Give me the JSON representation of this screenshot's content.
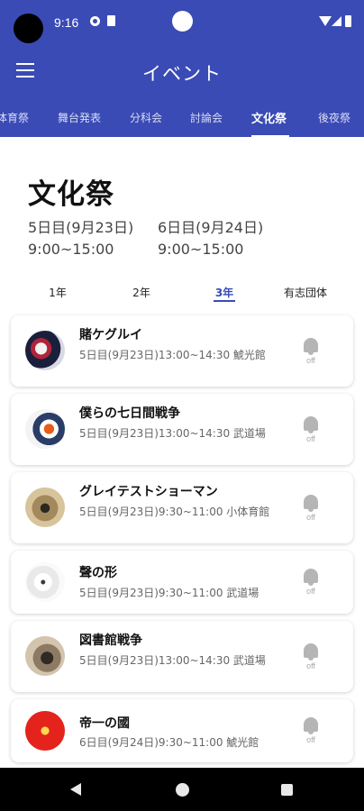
{
  "status_bar": {
    "time": "9:16"
  },
  "app_bar": {
    "title": "イベント"
  },
  "tabs": [
    "体育祭",
    "舞台発表",
    "分科会",
    "討論会",
    "文化祭",
    "後夜祭"
  ],
  "active_tab": "文化祭",
  "heading": "文化祭",
  "dates": [
    {
      "day": "5日目(9月23日)",
      "time": "9:00~15:00"
    },
    {
      "day": "6日目(9月24日)",
      "time": "9:00~15:00"
    }
  ],
  "grade_tabs": [
    "1年",
    "2年",
    "3年",
    "有志団体"
  ],
  "active_grade_tab": "3年",
  "events": [
    {
      "title": "賭ケグルイ",
      "meta": "5日目(9月23日)13:00~14:30 鯱光館",
      "bell_label": "off"
    },
    {
      "title": "僕らの七日間戦争",
      "meta": "5日目(9月23日)13:00~14:30 武道場",
      "bell_label": "off"
    },
    {
      "title": "グレイテストショーマン",
      "meta": "5日目(9月23日)9:30~11:00 小体育館",
      "bell_label": "off"
    },
    {
      "title": "聲の形",
      "meta": "5日目(9月23日)9:30~11:00 武道場",
      "bell_label": "off"
    },
    {
      "title": "図書館戦争",
      "meta": "5日目(9月23日)13:00~14:30 武道場",
      "bell_label": "off"
    },
    {
      "title": "帝一の國",
      "meta": "6日目(9月24日)9:30~11:00 鯱光館",
      "bell_label": "off"
    }
  ],
  "colors": {
    "primary": "#3a4bb5",
    "tab_inactive": "#d8dcf3",
    "bell": "#b5b5b5"
  },
  "icons": [
    "menu-icon",
    "bell-off-icon",
    "nav-back-icon",
    "nav-home-icon",
    "nav-recents-icon"
  ]
}
